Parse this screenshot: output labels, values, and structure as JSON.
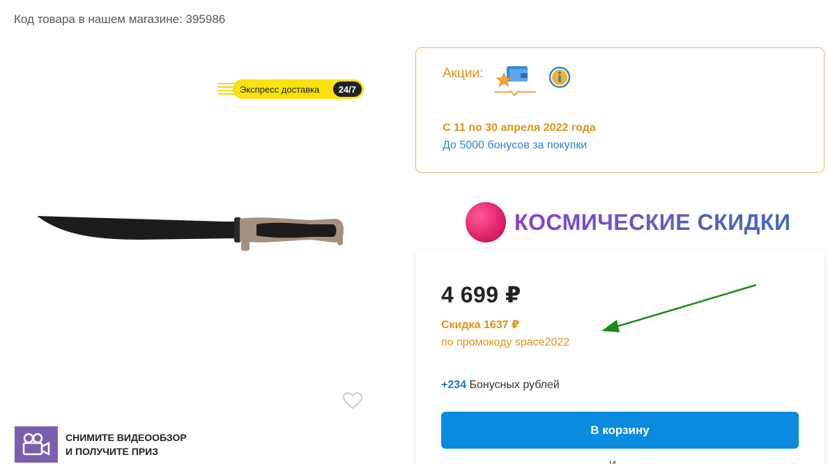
{
  "product": {
    "sku_text": "Код товара в нашем магазине: 395986"
  },
  "express": {
    "label": "Экспресс доставка",
    "tag": "24/7"
  },
  "video_promo": {
    "line1": "СНИМИТЕ ВИДЕООБЗОР",
    "line2": "И ПОЛУЧИТЕ ПРИЗ"
  },
  "promotions": {
    "label": "Акции:",
    "date_text": "С 11 по 30 апреля 2022 года",
    "description": "До 5000 бонусов за покупки"
  },
  "banner": {
    "title": "КОСМИЧЕСКИЕ СКИДКИ"
  },
  "pricing": {
    "price": "4 699 ₽",
    "discount": "Скидка 1637 ₽",
    "promo_code": "по промокоду space2022",
    "bonus_amount": "+234",
    "bonus_label": " Бонусных рублей",
    "cart_button": "В корзину",
    "tail": "И"
  },
  "colors": {
    "accent_orange": "#e09218",
    "link_blue": "#2e84cc",
    "button_blue": "#0a8be0",
    "video_purple": "#7a5fb1",
    "annotation_arrow": "#1a8a1a"
  },
  "icons": {
    "wallet": "wallet-star-icon",
    "info": "info-icon",
    "favorite": "heart-icon",
    "video": "video-camera-icon"
  }
}
